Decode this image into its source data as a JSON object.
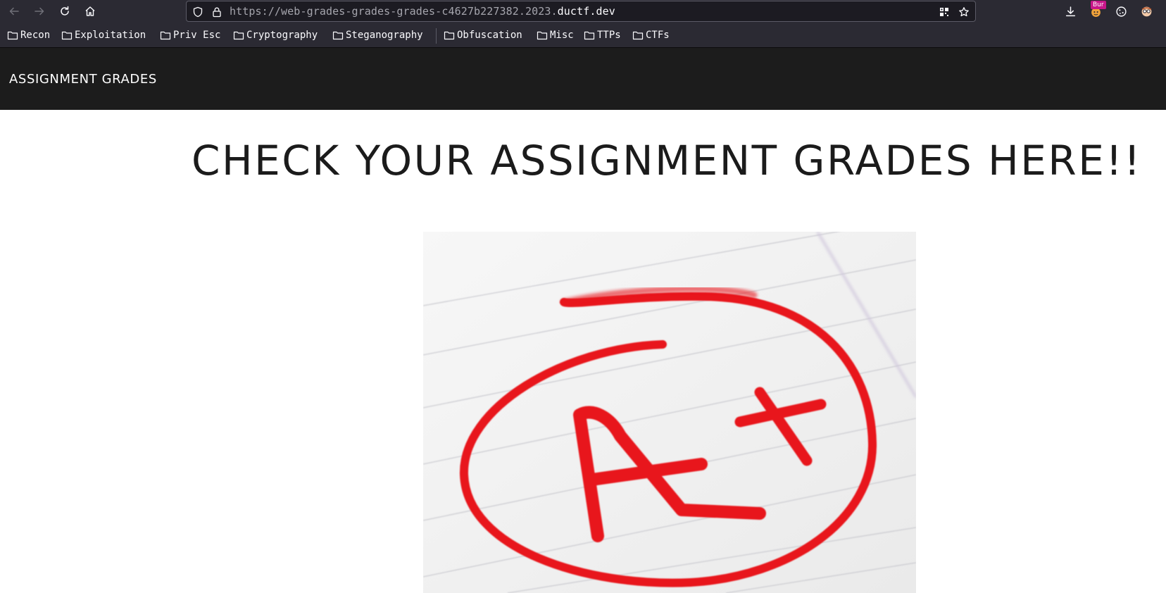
{
  "browser": {
    "url_prefix": "https://web-grades-grades-grades-c4627b227382.2023.",
    "url_domain": "ductf.dev",
    "extension_badge": "Bur"
  },
  "bookmarks": [
    {
      "label": "Recon"
    },
    {
      "label": "Exploitation"
    },
    {
      "label": "Priv Esc"
    },
    {
      "label": "Cryptography"
    },
    {
      "label": "Steganography"
    },
    {
      "label": "Obfuscation"
    },
    {
      "label": "Misc"
    },
    {
      "label": "TTPs"
    },
    {
      "label": "CTFs"
    }
  ],
  "page": {
    "brand": "ASSIGNMENT GRADES",
    "headline": "CHECK YOUR ASSIGNMENT GRADES HERE!!",
    "hero_image": "graded-paper-a-plus"
  },
  "colors": {
    "navbar_bg": "#1c1c1c",
    "ink_red": "#e8141b",
    "browser_chrome": "#2b2a33"
  }
}
